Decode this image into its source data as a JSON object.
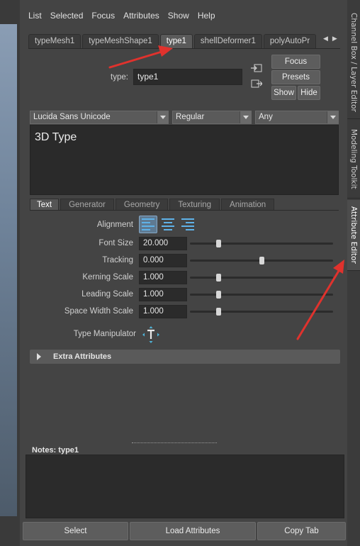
{
  "menu": [
    "List",
    "Selected",
    "Focus",
    "Attributes",
    "Show",
    "Help"
  ],
  "node_tabs": [
    "typeMesh1",
    "typeMeshShape1",
    "type1",
    "shellDeformer1",
    "polyAutoPr"
  ],
  "node_tabs_active": "type1",
  "type_field": {
    "label": "type:",
    "value": "type1"
  },
  "buttons": {
    "focus": "Focus",
    "presets": "Presets",
    "show": "Show",
    "hide": "Hide"
  },
  "font": {
    "family": "Lucida Sans Unicode",
    "style": "Regular",
    "writing_system": "Any"
  },
  "text_content": "3D Type",
  "sub_tabs": [
    "Text",
    "Generator",
    "Geometry",
    "Texturing",
    "Animation"
  ],
  "sub_tabs_active": "Text",
  "attributes": {
    "alignment_label": "Alignment",
    "font_size": {
      "label": "Font Size",
      "value": "20.000",
      "slider": 0.2
    },
    "tracking": {
      "label": "Tracking",
      "value": "0.000",
      "slider": 0.5
    },
    "kerning_scale": {
      "label": "Kerning Scale",
      "value": "1.000",
      "slider": 0.2
    },
    "leading_scale": {
      "label": "Leading Scale",
      "value": "1.000",
      "slider": 0.2
    },
    "space_width_scale": {
      "label": "Space Width Scale",
      "value": "1.000",
      "slider": 0.2
    },
    "type_manipulator_label": "Type Manipulator"
  },
  "extra_attributes": "Extra Attributes",
  "notes": {
    "label": "Notes:",
    "node": "type1"
  },
  "bottom_buttons": {
    "select": "Select",
    "load": "Load Attributes",
    "copy": "Copy Tab"
  },
  "side_tabs": [
    "Channel Box / Layer Editor",
    "Modeling Toolkit",
    "Attribute Editor"
  ],
  "side_tabs_active": "Attribute Editor",
  "colors": {
    "panel_bg": "#444444",
    "annotation_arrow": "#e0322d",
    "align_accent": "#5fb2e8"
  }
}
